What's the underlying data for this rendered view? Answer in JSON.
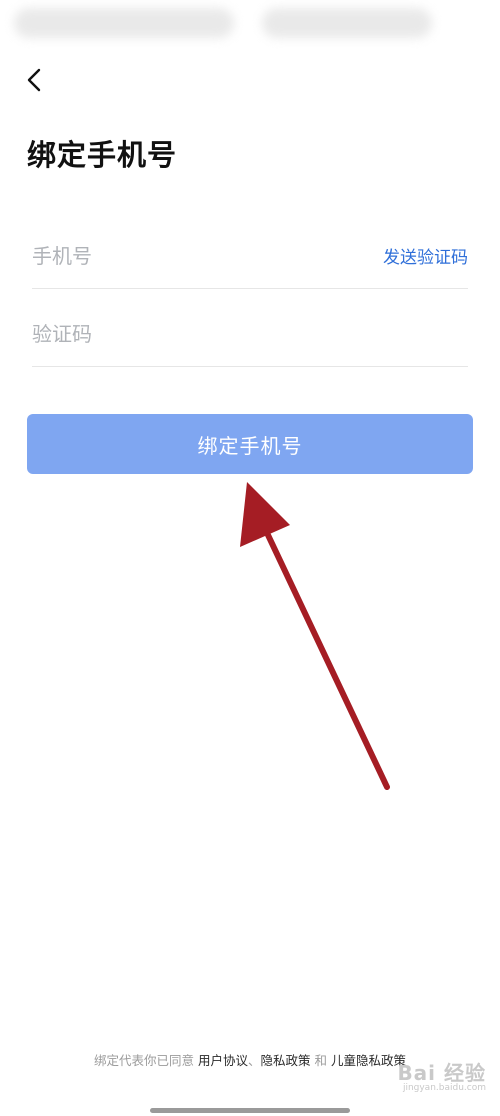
{
  "page": {
    "title": "绑定手机号"
  },
  "form": {
    "phone_placeholder": "手机号",
    "send_code_label": "发送验证码",
    "code_placeholder": "验证码",
    "submit_label": "绑定手机号"
  },
  "footer": {
    "prefix": "绑定代表你已同意",
    "user_agreement": "用户协议",
    "separator": "、",
    "privacy_policy": "隐私政策",
    "and": "和",
    "child_privacy_policy": "儿童隐私政策"
  },
  "watermark": {
    "main": "Bai 经验",
    "sub": "jingyan.baidu.com"
  },
  "colors": {
    "accent": "#2f6fd9",
    "button_bg": "#7fa6f1",
    "annotation_arrow": "#a51d24"
  },
  "icons": {
    "back": "chevron-left-icon",
    "annotation": "red-arrow-annotation"
  }
}
